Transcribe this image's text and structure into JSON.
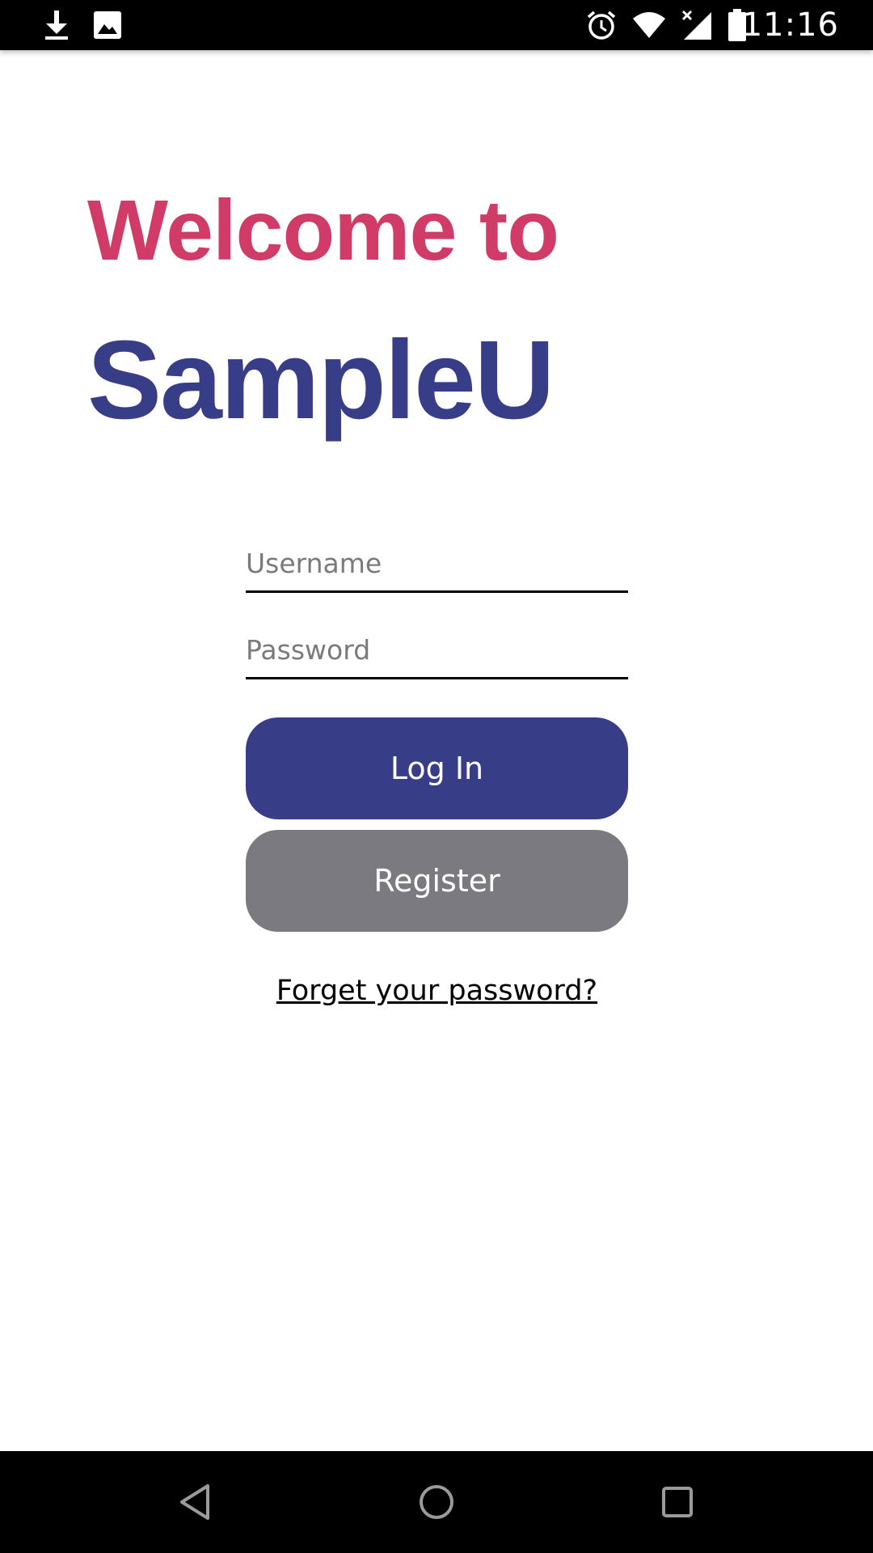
{
  "status_bar": {
    "time": "11:16",
    "left_icons": [
      "download-icon",
      "image-icon"
    ],
    "right_icons": [
      "alarm-icon",
      "wifi-icon",
      "signal-off-icon",
      "battery-icon"
    ]
  },
  "header": {
    "welcome_text": "Welcome to",
    "app_name": "SampleU"
  },
  "form": {
    "username_placeholder": "Username",
    "username_value": "",
    "password_placeholder": "Password",
    "password_value": "",
    "login_label": "Log In",
    "register_label": "Register",
    "forgot_label": "Forget your password?"
  },
  "nav_bar": {
    "icons": [
      "back-icon",
      "home-icon",
      "recents-icon"
    ]
  },
  "colors": {
    "welcome": "#d03b68",
    "brand": "#383d87",
    "login_button": "#383d87",
    "register_button": "#7a7a80",
    "status_bar": "#000000",
    "nav_bar": "#000000"
  }
}
